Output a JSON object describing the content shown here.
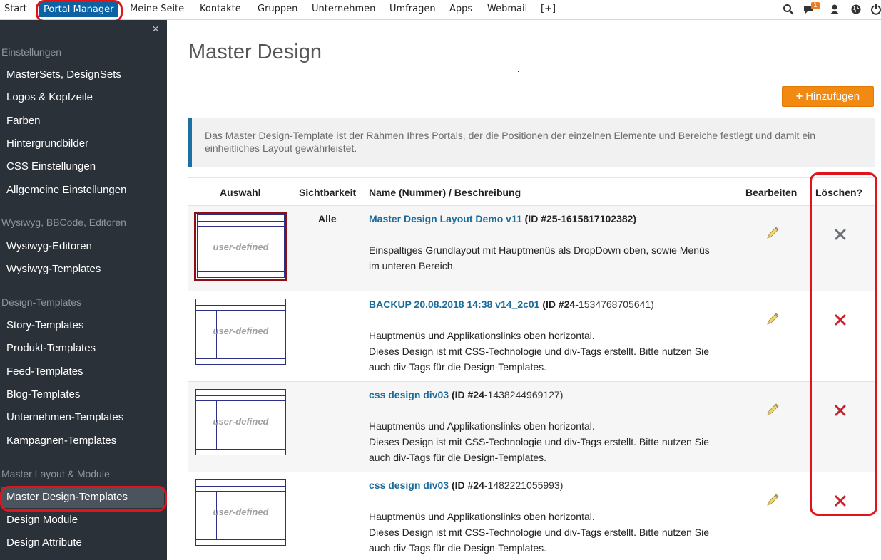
{
  "topnav": {
    "items": [
      "Start",
      "Portal Manager",
      "Meine Seite",
      "Kontakte",
      "Gruppen",
      "Unternehmen",
      "Umfragen",
      "Apps",
      "Webmail",
      "[+]"
    ],
    "message_count": "1",
    "icons": [
      "search-icon",
      "messages-icon",
      "user-icon",
      "globe-icon",
      "power-icon"
    ]
  },
  "sidebar": {
    "close": "×",
    "sections": [
      {
        "title": "Einstellungen",
        "items": [
          "MasterSets, DesignSets",
          "Logos & Kopfzeile",
          "Farben",
          "Hintergrundbilder",
          "CSS Einstellungen",
          "Allgemeine Einstellungen"
        ]
      },
      {
        "title": "Wysiwyg, BBCode, Editoren",
        "items": [
          "Wysiwyg-Editoren",
          "Wysiwyg-Templates"
        ]
      },
      {
        "title": "Design-Templates",
        "items": [
          "Story-Templates",
          "Produkt-Templates",
          "Feed-Templates",
          "Blog-Templates",
          "Unternehmen-Templates",
          "Kampagnen-Templates"
        ]
      },
      {
        "title": "Master Layout & Module",
        "items": [
          "Master Design-Templates",
          "Design Module",
          "Design Attribute"
        ]
      }
    ]
  },
  "main": {
    "title": "Master Design",
    "dot": ".",
    "add_button": "Hinzufügen",
    "add_plus": "+",
    "info": "Das Master Design-Template ist der Rahmen Ihres Portals, der die Positionen der einzelnen Elemente und Bereiche festlegt und damit ein einheitliches Layout gewährleistet.",
    "columns": [
      "Auswahl",
      "Sichtbarkeit",
      "Name (Nummer) / Beschreibung",
      "Bearbeiten",
      "Löschen?"
    ],
    "thumb_label": "user-defined",
    "rows": [
      {
        "name": "Master Design Layout Demo v11",
        "id_prefix": "(ID #25-1615817102382)",
        "id_rest": "",
        "visibility": "Alle",
        "desc_lines": [
          "Einspaltiges Grundlayout mit Hauptmenüs als DropDown oben, sowie Menüs",
          "im unteren Bereich."
        ]
      },
      {
        "name": "BACKUP 20.08.2018 14:38 v14_2c01",
        "id_prefix": "(ID #24",
        "id_rest": "-1534768705641)",
        "visibility": "",
        "desc_lines": [
          "Hauptmenüs und Applikationslinks oben horizontal.",
          "Dieses Design ist mit CSS-Technologie und div-Tags erstellt. Bitte nutzen Sie",
          "auch div-Tags für die Design-Templates."
        ]
      },
      {
        "name": "css design div03",
        "id_prefix": "(ID #24",
        "id_rest": "-1438244969127)",
        "visibility": "",
        "desc_lines": [
          "Hauptmenüs und Applikationslinks oben horizontal.",
          "Dieses Design ist mit CSS-Technologie und div-Tags erstellt. Bitte nutzen Sie",
          "auch div-Tags für die Design-Templates."
        ]
      },
      {
        "name": "css design div03",
        "id_prefix": "(ID #24",
        "id_rest": "-1482221055993)",
        "visibility": "",
        "desc_lines": [
          "Hauptmenüs und Applikationslinks oben horizontal.",
          "Dieses Design ist mit CSS-Technologie und div-Tags erstellt. Bitte nutzen Sie",
          "auch div-Tags für die Design-Templates."
        ]
      }
    ]
  },
  "colors": {
    "accent": "#0b63a3",
    "button": "#f28a12",
    "sidebar": "#2a3138",
    "link": "#1a6c9c",
    "delete": "#c9202a",
    "highlight": "#e0141b"
  }
}
